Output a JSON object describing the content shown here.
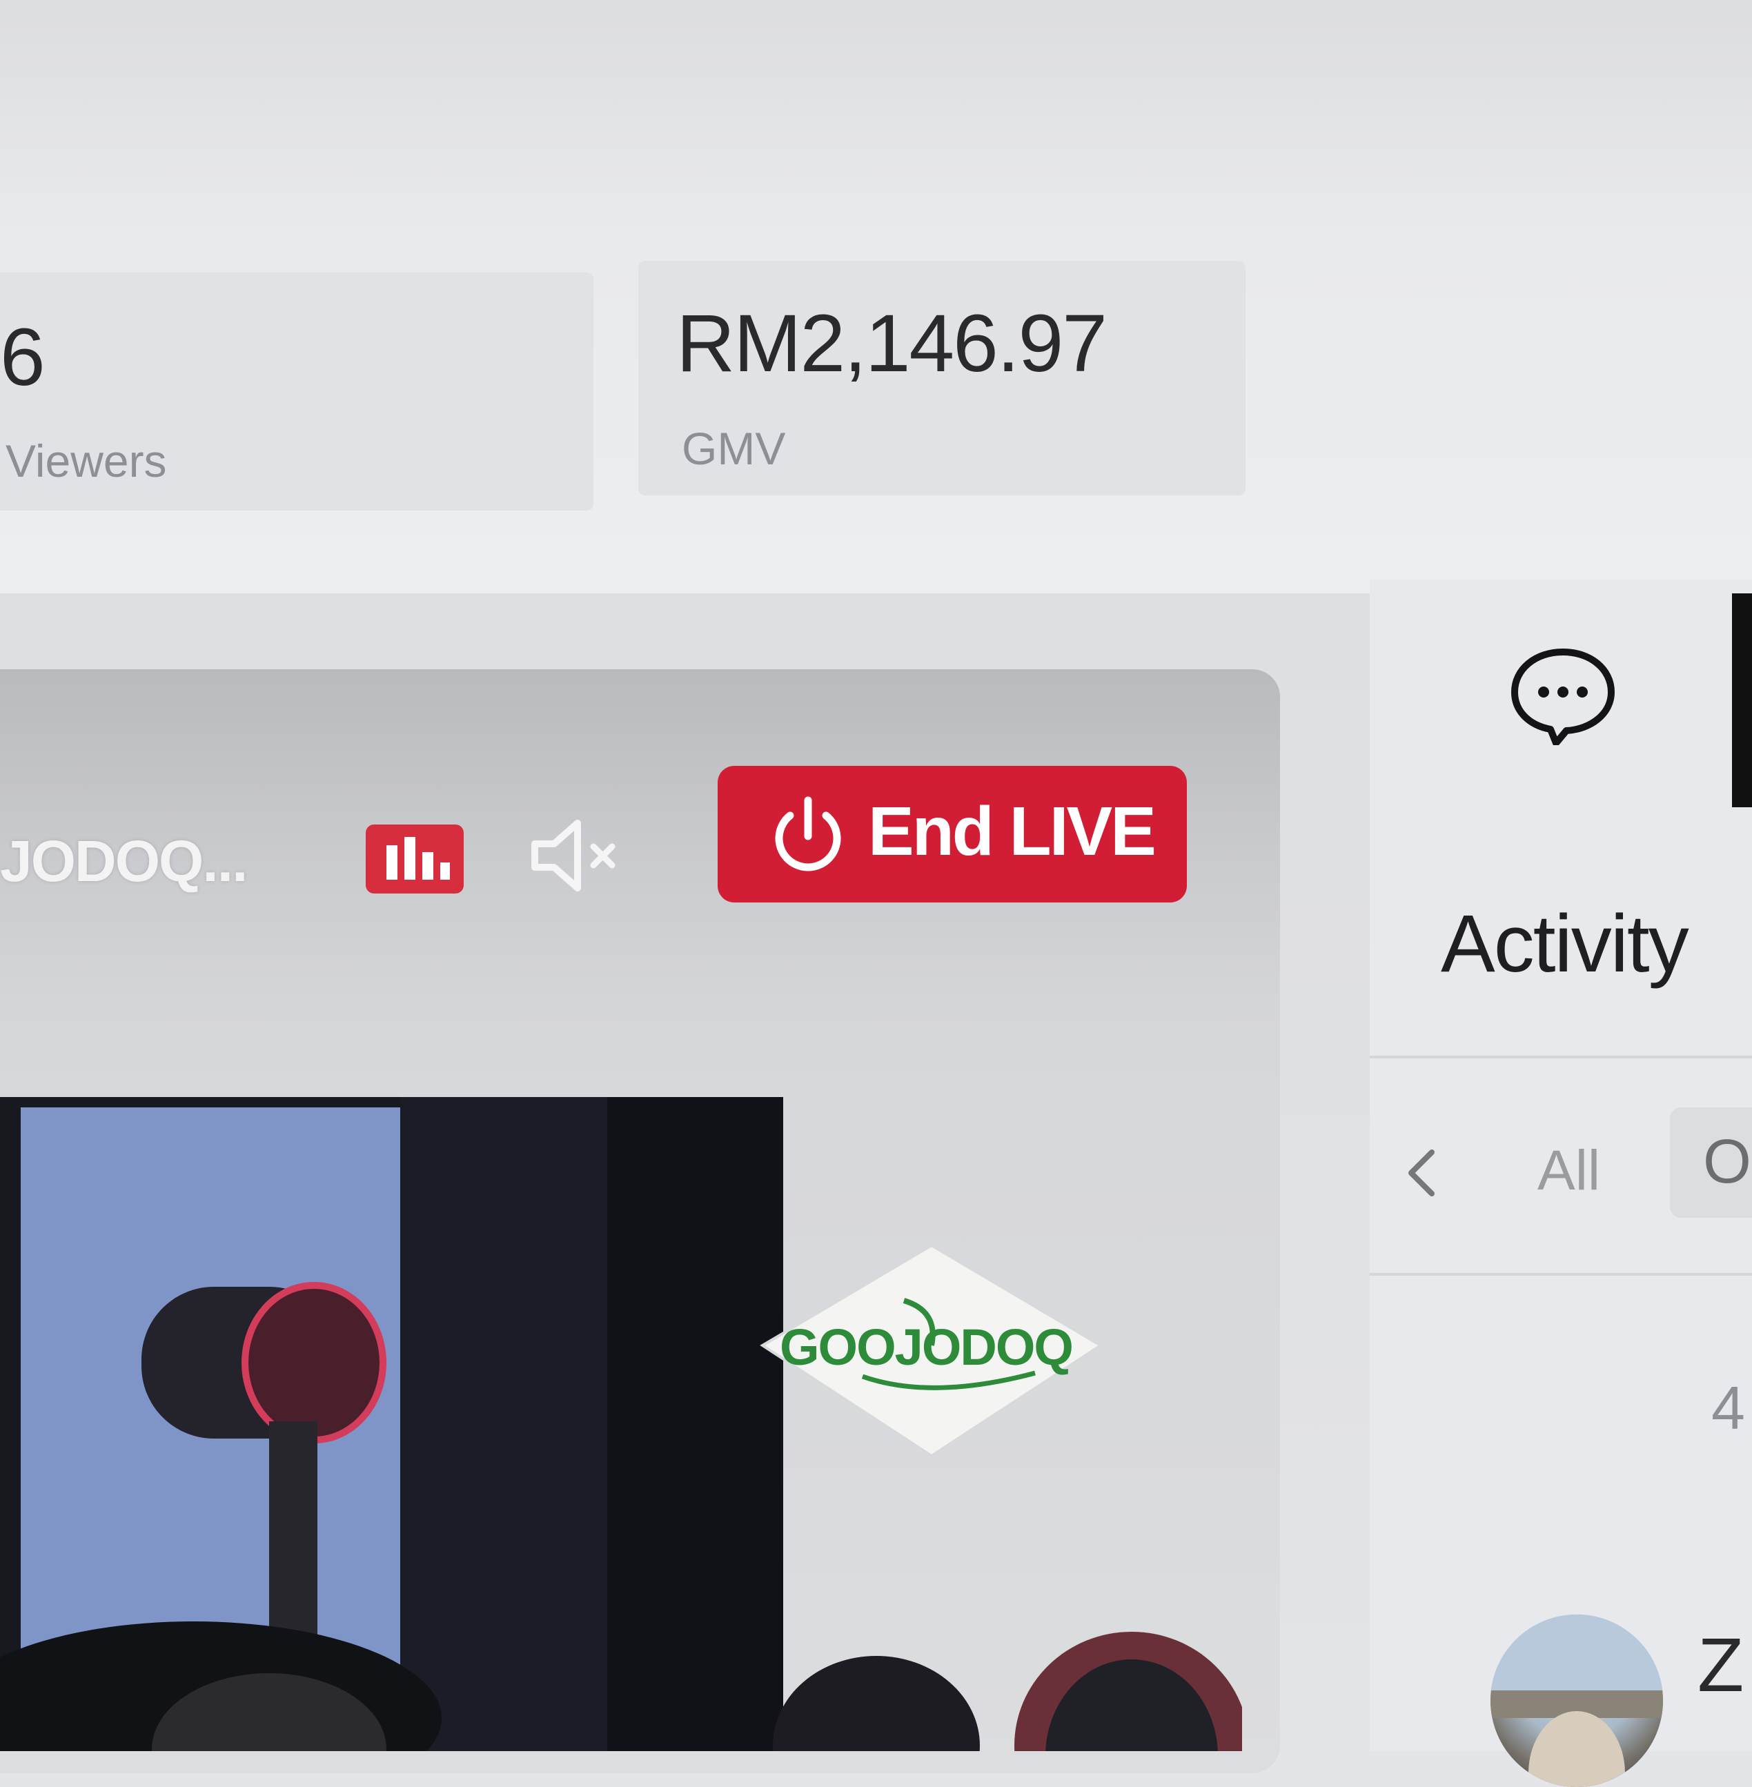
{
  "stats": [
    {
      "value": "6",
      "label": "Viewers"
    },
    {
      "value": "RM2,146.97",
      "label": "GMV"
    }
  ],
  "live_controls": {
    "stream_name": "JODOQ...",
    "stats_icon": "bar-chart-icon",
    "mute_icon": "speaker-muted-icon",
    "end_button_icon": "power-icon",
    "end_button_label": "End LIVE"
  },
  "logo_text": "GOOJODOQ",
  "side_panel": {
    "chat_icon": "chat-bubble-icon",
    "title": "Activity",
    "filters": {
      "back_icon": "chevron-left-icon",
      "all_label": "All",
      "next_label": "O"
    },
    "count": "4",
    "activity_items": [
      {
        "avatar": "avatar",
        "name_initial": "Z"
      }
    ]
  },
  "colors": {
    "end_live_red": "#d21e35",
    "badge_red": "#d62e3e",
    "logo_green": "#2e8b3a"
  }
}
